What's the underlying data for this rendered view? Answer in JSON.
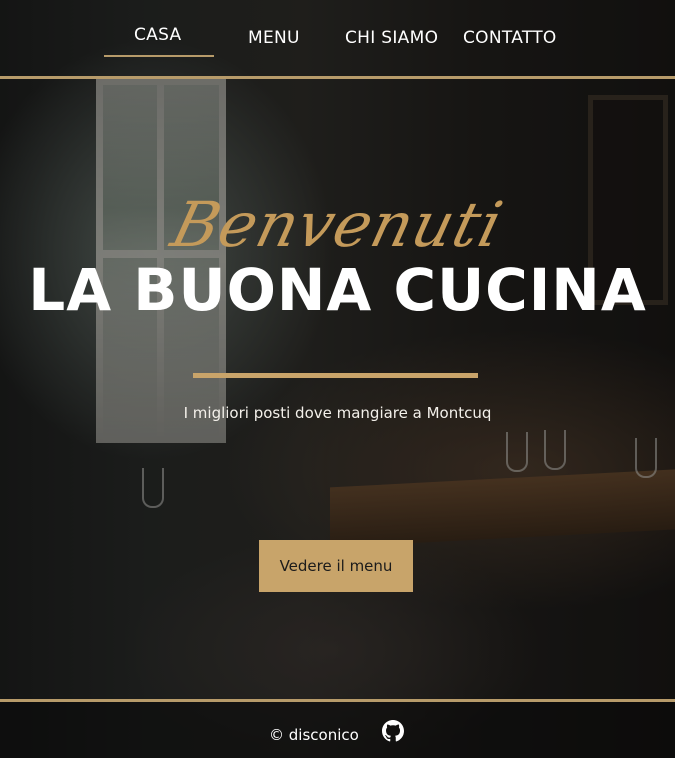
{
  "nav": {
    "home": "CASA",
    "menu": "MENU",
    "about": "CHI SIAMO",
    "contact": "CONTATTO"
  },
  "hero": {
    "script_title": "Benvenuti",
    "title": "LA BUONA CUCINA",
    "subtitle": "I migliori posti dove mangiare a Montcuq",
    "cta": "Vedere il menu"
  },
  "footer": {
    "copyright": "© disconico",
    "icon": "github-icon"
  },
  "colors": {
    "accent": "#c8a46a",
    "text": "#ffffff",
    "script": "#c49a5a"
  }
}
